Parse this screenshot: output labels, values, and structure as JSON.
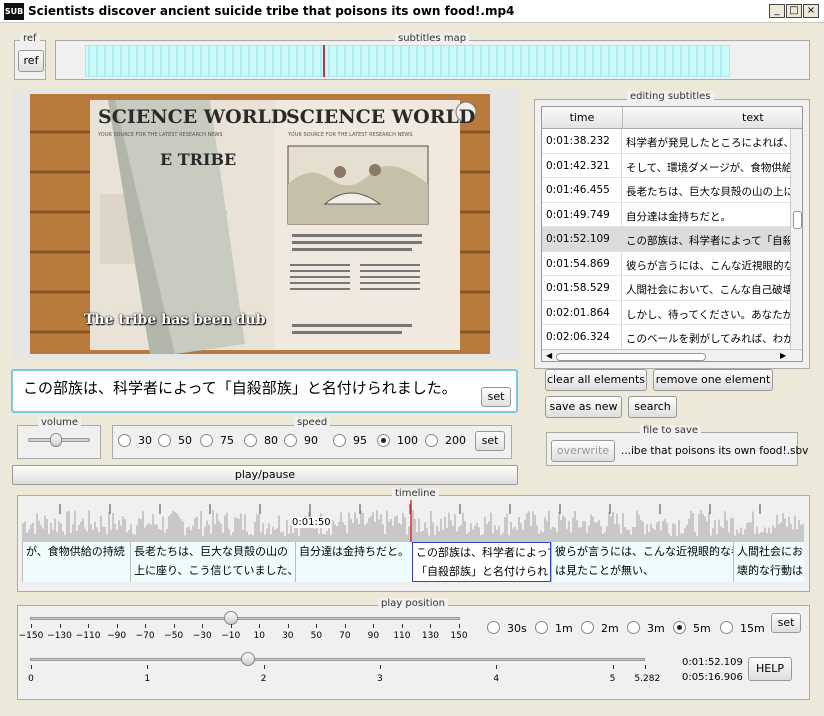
{
  "window": {
    "icon_label": "SUB",
    "title": "Scientists discover ancient suicide tribe that poisons its own food!.mp4",
    "min_label": "_",
    "max_label": "□",
    "close_label": "×"
  },
  "ref": {
    "legend": "ref",
    "button": "ref"
  },
  "subtitles_map": {
    "legend": "subtitles map"
  },
  "video": {
    "masthead": "SCIENCE WORLD",
    "tagline": "YOUR SOURCE FOR THE LATEST RESEARCH NEWS",
    "left_headline": "E TRIBE",
    "caption_overlay": "The tribe has been dub"
  },
  "subtitle_edit": {
    "text": "この部族は、科学者によって「自殺部族」と名付けられました。",
    "set_button": "set"
  },
  "volume": {
    "legend": "volume",
    "level": 0.45
  },
  "speed": {
    "legend": "speed",
    "options": [
      "30",
      "50",
      "75",
      "80",
      "90",
      "95",
      "100",
      "200"
    ],
    "selected": "100",
    "set_button": "set"
  },
  "play_pause": "play/pause",
  "editing": {
    "legend": "editing subtitles",
    "col_time": "time",
    "col_text": "text",
    "rows": [
      {
        "time": "0:01:38.232",
        "text": "科学者が発見したところによれば、こ"
      },
      {
        "time": "0:01:42.321",
        "text": "そして、環境ダメージが、食物供給の"
      },
      {
        "time": "0:01:46.455",
        "text": "長老たちは、巨大な貝殻の山の上に"
      },
      {
        "time": "0:01:49.749",
        "text": "自分達は金持ちだと。"
      },
      {
        "time": "0:01:52.109",
        "text": "この部族は、科学者によって「自殺部"
      },
      {
        "time": "0:01:54.869",
        "text": "彼らが言うには、こんな近視眼的な"
      },
      {
        "time": "0:01:58.529",
        "text": "人間社会において、こんな自己破壊"
      },
      {
        "time": "0:02:01.864",
        "text": "しかし、待ってください。あなたが、こ"
      },
      {
        "time": "0:02:06.324",
        "text": "このベールを剥がしてみれば、わかり"
      }
    ],
    "selected_index": 4,
    "buttons": {
      "clear_all": "clear all elements",
      "remove_one": "remove one element",
      "save_as_new": "save as new",
      "search": "search"
    }
  },
  "file_to_save": {
    "legend": "file to save",
    "overwrite": "overwrite",
    "filename": "...ibe that poisons its own food!.sbv"
  },
  "timeline": {
    "legend": "timeline",
    "time_label": "0:01:50",
    "segments": [
      {
        "line1": "が、食物供給の持続",
        "line2": ""
      },
      {
        "line1": "長老たちは、巨大な貝殻の山の",
        "line2": "上に座り、こう信じていました、"
      },
      {
        "line1": "自分達は金持ちだと。",
        "line2": ""
      },
      {
        "line1": "この部族は、科学者によって",
        "line2": "「自殺部族」と名付けられま"
      },
      {
        "line1": "彼らが言うには、こんな近視眼的な者",
        "line2": "は見たことが無い、"
      },
      {
        "line1": "人間社会にお",
        "line2": "壊的な行動は"
      }
    ]
  },
  "play_position": {
    "legend": "play position",
    "offset_ticks": [
      "−150",
      "−130",
      "−110",
      "−90",
      "−70",
      "−50",
      "−30",
      "−10",
      "10",
      "30",
      "50",
      "70",
      "90",
      "110",
      "130",
      "150"
    ],
    "offset_value": -10,
    "jump_options": [
      "30s",
      "1m",
      "2m",
      "3m",
      "5m",
      "15m"
    ],
    "jump_selected": "5m",
    "set_button": "set",
    "position_ticks": [
      "0",
      "1",
      "2",
      "3",
      "4",
      "5",
      "5.282"
    ],
    "position_value": 1.87,
    "current_time": "0:01:52.109",
    "total_time": "0:05:16.906",
    "help_button": "HELP"
  }
}
